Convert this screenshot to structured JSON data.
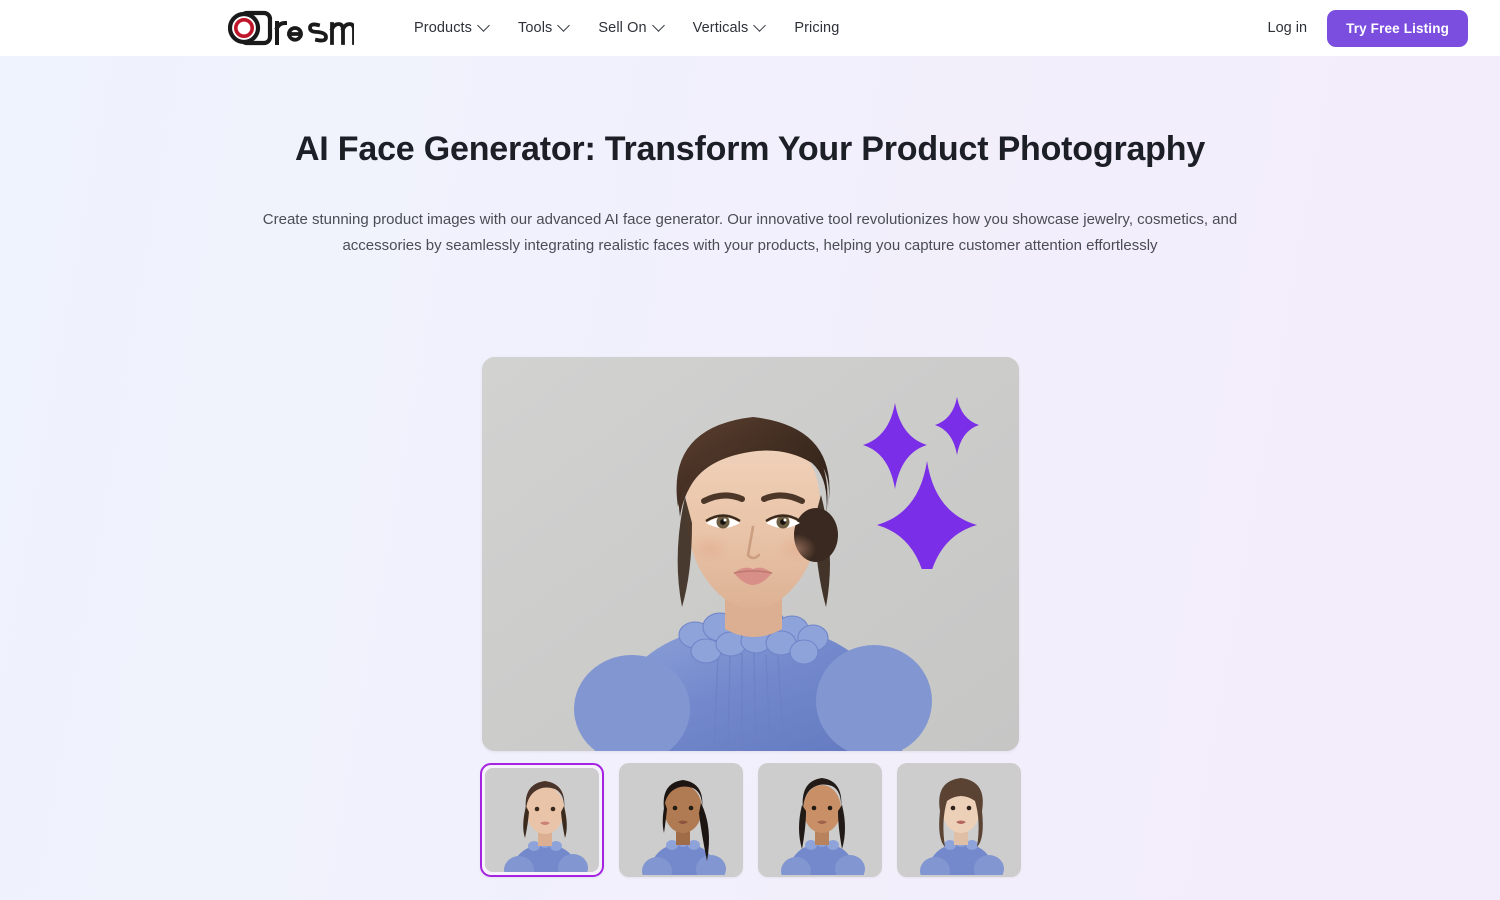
{
  "brand": {
    "name": "Dresma",
    "logo_icon": "dresma-camera-lens-logo",
    "lens_color": "#c0162a",
    "logo_color": "#1a1a1a"
  },
  "header": {
    "nav_items": [
      {
        "label": "Products",
        "has_dropdown": true,
        "icon": "chevron-down-icon"
      },
      {
        "label": "Tools",
        "has_dropdown": true,
        "icon": "chevron-down-icon"
      },
      {
        "label": "Sell On",
        "has_dropdown": true,
        "icon": "chevron-down-icon"
      },
      {
        "label": "Verticals",
        "has_dropdown": true,
        "icon": "chevron-down-icon"
      },
      {
        "label": "Pricing",
        "has_dropdown": false,
        "icon": ""
      }
    ],
    "login_label": "Log in",
    "cta_label": "Try Free Listing",
    "cta_color": "#7b4ee0"
  },
  "hero": {
    "title": "AI Face Generator: Transform Your Product Photography",
    "subtitle": "Create stunning product images with our advanced AI face generator. Our innovative tool revolutionizes how you showcase jewelry, cosmetics, and accessories by seamlessly integrating realistic faces with your products, helping you capture customer attention effortlessly"
  },
  "showcase": {
    "main_image": {
      "name": "ai-generated-model-portrait",
      "alt": "Woman with brown hair in blue ruffled high-neck blouse on grey backdrop",
      "background": "#cdcdcd",
      "sparkle_color": "#7b2ee8",
      "sparkle_icon": "sparkle-star-icon",
      "sparkle_count": 3
    },
    "thumbnails": [
      {
        "name": "face-variant-1",
        "alt": "Brunette model portrait",
        "selected": true,
        "hair": "#4a3328",
        "skin": "#e7c3a8"
      },
      {
        "name": "face-variant-2",
        "alt": "Model with long straight dark hair",
        "selected": false,
        "hair": "#1d1512",
        "skin": "#b07a52"
      },
      {
        "name": "face-variant-3",
        "alt": "Model with dark hair portrait",
        "selected": false,
        "hair": "#211a17",
        "skin": "#c99068"
      },
      {
        "name": "face-variant-4",
        "alt": "Model with shoulder-length hair",
        "selected": false,
        "hair": "#5a4332",
        "skin": "#ecd0b8"
      }
    ],
    "selected_border_color": "#a522e0",
    "garment_color": "#7d95d4"
  }
}
